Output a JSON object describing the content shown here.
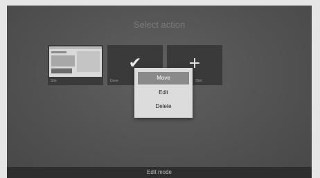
{
  "header": {
    "title": "Select action"
  },
  "tiles": [
    {
      "label": "Site",
      "icon": "webpage-thumbnail-icon"
    },
    {
      "label": "Done",
      "icon": "checkmark-icon",
      "glyph": "✔"
    },
    {
      "label": "Dial",
      "icon": "plus-icon",
      "glyph": "+"
    }
  ],
  "menu": {
    "items": [
      {
        "label": "Move",
        "selected": true
      },
      {
        "label": "Edit",
        "selected": false
      },
      {
        "label": "Delete",
        "selected": false
      }
    ]
  },
  "footer": {
    "status": "Edit mode"
  },
  "colors": {
    "background": "#525252",
    "menu_bg": "#dcdcdc",
    "menu_selected": "#8a8a8a",
    "tile_bg": "#3a3a3a",
    "footer_bg": "#2e2e2e"
  }
}
